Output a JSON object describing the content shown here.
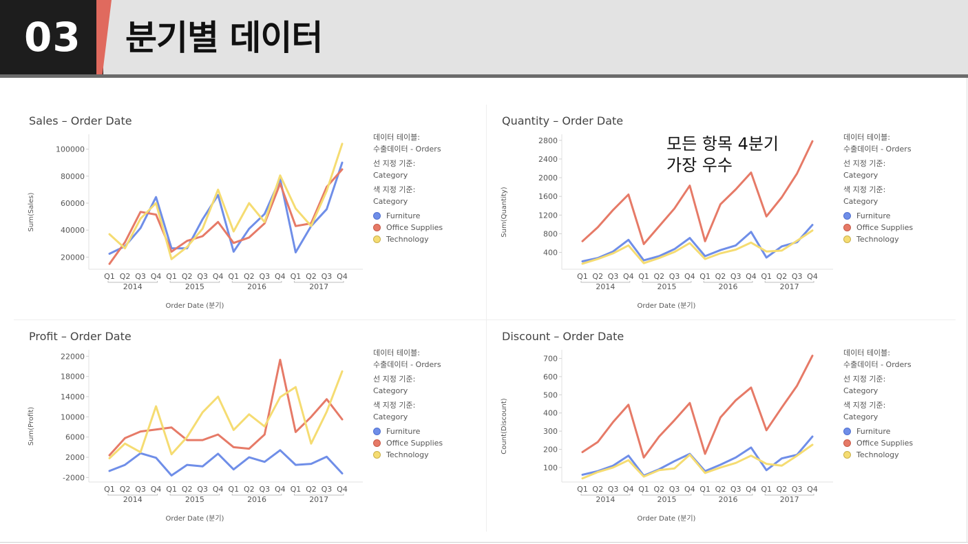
{
  "header": {
    "section_number": "03",
    "title": "분기별 데이터"
  },
  "annotation": "모든 항목 4분기\n가장 우수",
  "colors": {
    "Furniture": "#6f8ee8",
    "Office Supplies": "#e67a67",
    "Technology": "#f5dc72"
  },
  "legend": {
    "table_label": "데이터 테이블:",
    "table_value": "수출데이터 - Orders",
    "line_label": "선 지정 기준:",
    "line_value": "Category",
    "color_label": "색 지정 기준:",
    "color_value": "Category",
    "items": [
      "Furniture",
      "Office Supplies",
      "Technology"
    ]
  },
  "chart_data": [
    {
      "type": "line",
      "title": "Sales – Order Date",
      "xlabel": "Order Date (분기)",
      "ylabel": "Sum(Sales)",
      "categories": [
        "Q1",
        "Q2",
        "Q3",
        "Q4",
        "Q1",
        "Q2",
        "Q3",
        "Q4",
        "Q1",
        "Q2",
        "Q3",
        "Q4",
        "Q1",
        "Q2",
        "Q3",
        "Q4"
      ],
      "years": [
        "2014",
        "2015",
        "2016",
        "2017"
      ],
      "yticks": [
        20000,
        40000,
        60000,
        80000,
        100000
      ],
      "ylim": [
        11000,
        110000
      ],
      "series": [
        {
          "name": "Furniture",
          "values": [
            22500,
            28000,
            41500,
            64500,
            26500,
            26500,
            48000,
            66000,
            24000,
            41000,
            52000,
            78000,
            23500,
            43000,
            55500,
            90000
          ]
        },
        {
          "name": "Office Supplies",
          "values": [
            15000,
            31000,
            53500,
            51500,
            24000,
            32000,
            35500,
            46000,
            30500,
            34500,
            45000,
            74500,
            43000,
            45000,
            72000,
            85000
          ]
        },
        {
          "name": "Technology",
          "values": [
            37000,
            26500,
            48500,
            60000,
            18500,
            27500,
            41000,
            70000,
            39000,
            60000,
            46000,
            80500,
            56000,
            43000,
            69000,
            104000
          ]
        }
      ]
    },
    {
      "type": "line",
      "title": "Quantity – Order Date",
      "xlabel": "Order Date (분기)",
      "ylabel": "Sum(Quantity)",
      "categories": [
        "Q1",
        "Q2",
        "Q3",
        "Q4",
        "Q1",
        "Q2",
        "Q3",
        "Q4",
        "Q1",
        "Q2",
        "Q3",
        "Q4",
        "Q1",
        "Q2",
        "Q3",
        "Q4"
      ],
      "years": [
        "2014",
        "2015",
        "2016",
        "2017"
      ],
      "yticks": [
        400,
        800,
        1200,
        1600,
        2000,
        2400,
        2800
      ],
      "ylim": [
        40,
        2900
      ],
      "series": [
        {
          "name": "Furniture",
          "values": [
            210,
            280,
            420,
            670,
            230,
            320,
            470,
            710,
            320,
            450,
            550,
            840,
            290,
            530,
            620,
            990
          ]
        },
        {
          "name": "Office Supplies",
          "values": [
            640,
            940,
            1310,
            1640,
            580,
            960,
            1340,
            1830,
            640,
            1430,
            1750,
            2110,
            1170,
            1580,
            2090,
            2780
          ]
        },
        {
          "name": "Technology",
          "values": [
            160,
            260,
            380,
            550,
            170,
            280,
            410,
            600,
            260,
            380,
            460,
            610,
            420,
            440,
            650,
            870
          ]
        }
      ]
    },
    {
      "type": "line",
      "title": "Profit – Order Date",
      "xlabel": "Order Date (분기)",
      "ylabel": "Sum(Profit)",
      "categories": [
        "Q1",
        "Q2",
        "Q3",
        "Q4",
        "Q1",
        "Q2",
        "Q3",
        "Q4",
        "Q1",
        "Q2",
        "Q3",
        "Q4",
        "Q1",
        "Q2",
        "Q3",
        "Q4"
      ],
      "years": [
        "2014",
        "2015",
        "2016",
        "2017"
      ],
      "yticks": [
        -2000,
        2000,
        6000,
        10000,
        14000,
        18000,
        22000
      ],
      "ylim": [
        -2900,
        23000
      ],
      "series": [
        {
          "name": "Furniture",
          "values": [
            -700,
            500,
            2800,
            1900,
            -1600,
            500,
            200,
            2700,
            -400,
            2000,
            1100,
            3400,
            500,
            700,
            2100,
            -1200
          ]
        },
        {
          "name": "Office Supplies",
          "values": [
            2400,
            5800,
            7100,
            7500,
            7900,
            5400,
            5400,
            6500,
            4000,
            3700,
            6500,
            21300,
            7000,
            10000,
            13500,
            9500
          ]
        },
        {
          "name": "Technology",
          "values": [
            1800,
            4700,
            3000,
            12100,
            2600,
            6000,
            10900,
            14000,
            7400,
            10500,
            8100,
            13900,
            15900,
            4700,
            11000,
            19000
          ]
        }
      ]
    },
    {
      "type": "line",
      "title": "Discount – Order Date",
      "xlabel": "Order Date (분기)",
      "ylabel": "Count(Discount)",
      "categories": [
        "Q1",
        "Q2",
        "Q3",
        "Q4",
        "Q1",
        "Q2",
        "Q3",
        "Q4",
        "Q1",
        "Q2",
        "Q3",
        "Q4",
        "Q1",
        "Q2",
        "Q3",
        "Q4"
      ],
      "years": [
        "2014",
        "2015",
        "2016",
        "2017"
      ],
      "yticks": [
        100,
        200,
        300,
        400,
        500,
        600,
        700
      ],
      "ylim": [
        20,
        740
      ],
      "series": [
        {
          "name": "Furniture",
          "values": [
            60,
            80,
            110,
            165,
            55,
            90,
            135,
            175,
            80,
            115,
            155,
            210,
            85,
            150,
            170,
            270
          ]
        },
        {
          "name": "Office Supplies",
          "values": [
            185,
            240,
            350,
            445,
            155,
            270,
            360,
            455,
            175,
            375,
            470,
            540,
            305,
            430,
            550,
            715
          ]
        },
        {
          "name": "Technology",
          "values": [
            40,
            75,
            100,
            140,
            50,
            85,
            95,
            170,
            70,
            100,
            125,
            165,
            120,
            110,
            165,
            225
          ]
        }
      ]
    }
  ]
}
